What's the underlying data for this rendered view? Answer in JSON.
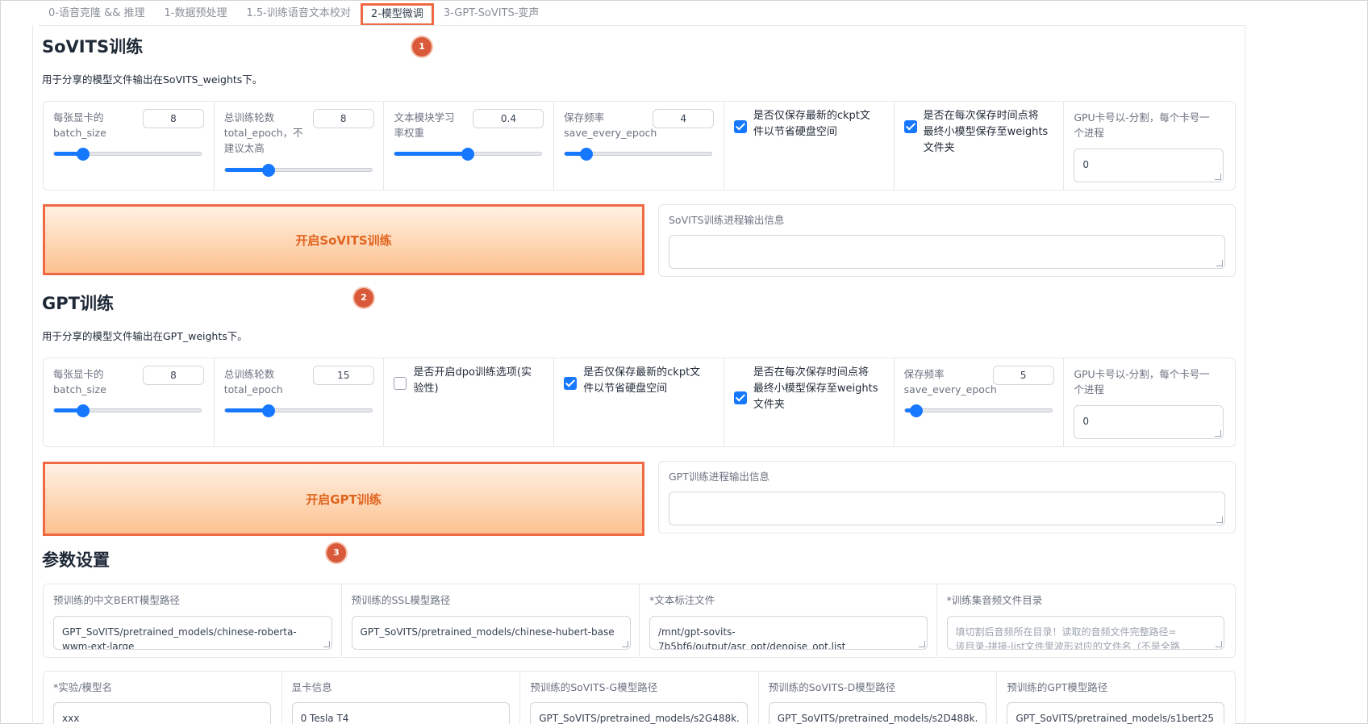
{
  "tabs": [
    "0-语音克隆 && 推理",
    "1-数据预处理",
    "1.5-训练语音文本校对",
    "2-模型微调",
    "3-GPT-SoVITS-变声"
  ],
  "active_tab": 3,
  "colors": {
    "accent": "#1677ff",
    "highlight": "#ef6a43",
    "button_text": "#e0641e",
    "marker": "#d95a3a"
  },
  "markers": [
    "1",
    "2",
    "3"
  ],
  "sovits": {
    "title": "SoVITS训练",
    "desc": "用于分享的模型文件输出在SoVITS_weights下。",
    "batch_label": "每张显卡的\nbatch_size",
    "batch_value": "8",
    "batch_level": 0.2,
    "epoch_label": "总训练轮数\ntotal_epoch，不\n建议太高",
    "epoch_value": "8",
    "epoch_level": 0.3,
    "textlr_label": "文本模块学习\n率权重",
    "textlr_value": "0.4",
    "textlr_level": 0.5,
    "save_label": "保存频率\nsave_every_epoch",
    "save_value": "4",
    "save_level": 0.15,
    "latest_label": "是否仅保存最新的ckpt文\n件以节省硬盘空间",
    "latest_checked": true,
    "small_label": "是否在每次保存时间点将\n最终小模型保存至weights\n文件夹",
    "small_checked": true,
    "gpu_label": "GPU卡号以-分割，每个卡号一\n个进程",
    "gpu_value": "0",
    "button": "开启SoVITS训练",
    "output_label": "SoVITS训练进程输出信息"
  },
  "gpt": {
    "title": "GPT训练",
    "desc": "用于分享的模型文件输出在GPT_weights下。",
    "batch_label": "每张显卡的\nbatch_size",
    "batch_value": "8",
    "batch_level": 0.2,
    "epoch_label": "总训练轮数\ntotal_epoch",
    "epoch_value": "15",
    "epoch_level": 0.3,
    "dpo_label": "是否开启dpo训练选项(实\n验性)",
    "dpo_checked": false,
    "latest_label": "是否仅保存最新的ckpt文\n件以节省硬盘空间",
    "latest_checked": true,
    "small_label": "是否在每次保存时间点将\n最终小模型保存至weights\n文件夹",
    "small_checked": true,
    "save_label": "保存频率\nsave_every_epoch",
    "save_value": "5",
    "save_level": 0.08,
    "gpu_label": "GPU卡号以-分割，每个卡号一\n个进程",
    "gpu_value": "0",
    "button": "开启GPT训练",
    "output_label": "GPT训练进程输出信息"
  },
  "params": {
    "title": "参数设置",
    "row1": [
      {
        "label": "预训练的中文BERT模型路径",
        "value": "GPT_SoVITS/pretrained_models/chinese-roberta-\nwwm-ext-large",
        "placeholder": false
      },
      {
        "label": "预训练的SSL模型路径",
        "value": "GPT_SoVITS/pretrained_models/chinese-hubert-base",
        "placeholder": false
      },
      {
        "label": "*文本标注文件",
        "value": "/mnt/gpt-sovits-\n7b5bf6/output/asr_opt/denoise_opt.list",
        "placeholder": false
      },
      {
        "label": "*训练集音频文件目录",
        "value": "填切割后音频所在目录！读取的音频文件完整路径=\n该目录-拼接-list文件里波形对应的文件名（不是全路",
        "placeholder": true
      }
    ],
    "row2": [
      {
        "label": "*实验/模型名",
        "value": "xxx"
      },
      {
        "label": "显卡信息",
        "value": "0 Tesla T4"
      },
      {
        "label": "预训练的SoVITS-G模型路径",
        "value": "GPT_SoVITS/pretrained_models/s2G488k."
      },
      {
        "label": "预训练的SoVITS-D模型路径",
        "value": "GPT_SoVITS/pretrained_models/s2D488k."
      },
      {
        "label": "预训练的GPT模型路径",
        "value": "GPT_SoVITS/pretrained_models/s1bert25"
      }
    ]
  }
}
